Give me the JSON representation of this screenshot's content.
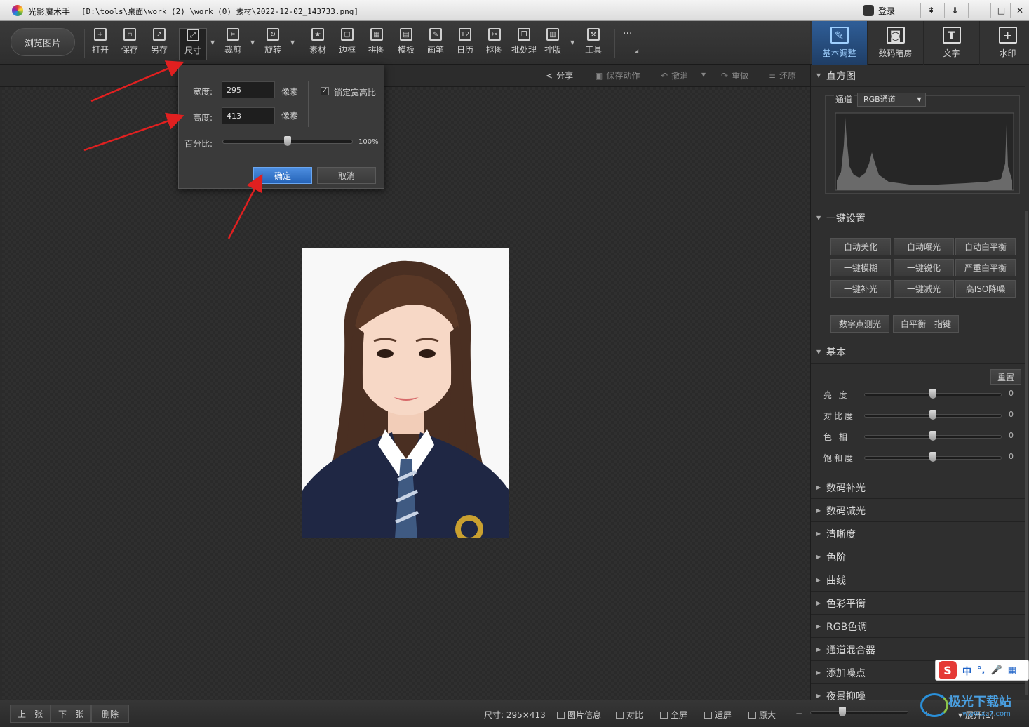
{
  "window": {
    "app_title": "光影魔术手",
    "file_path": "[D:\\tools\\桌面\\work (2) \\work (0) 素材\\2022-12-02_143733.png]",
    "login_label": "登录",
    "controls": [
      "⇞",
      "⇓",
      "—",
      "□",
      "✕"
    ]
  },
  "toolbar": {
    "browse_label": "浏览图片",
    "tools": [
      {
        "label": "打开",
        "icon": "open-icon",
        "glyph": "+"
      },
      {
        "label": "保存",
        "icon": "save-icon",
        "glyph": "▫"
      },
      {
        "label": "另存",
        "icon": "save-as-icon",
        "glyph": "↗"
      },
      {
        "label": "尺寸",
        "icon": "resize-icon",
        "glyph": "⤢"
      },
      {
        "label": "裁剪",
        "icon": "crop-icon",
        "glyph": "⌗"
      },
      {
        "label": "旋转",
        "icon": "rotate-icon",
        "glyph": "↻"
      },
      {
        "label": "素材",
        "icon": "material-icon",
        "glyph": "★"
      },
      {
        "label": "边框",
        "icon": "frame-icon",
        "glyph": "▢"
      },
      {
        "label": "拼图",
        "icon": "collage-icon",
        "glyph": "▦"
      },
      {
        "label": "模板",
        "icon": "template-icon",
        "glyph": "▤"
      },
      {
        "label": "画笔",
        "icon": "brush-icon",
        "glyph": "✎"
      },
      {
        "label": "日历",
        "icon": "calendar-icon",
        "glyph": "12"
      },
      {
        "label": "抠图",
        "icon": "cutout-icon",
        "glyph": "✂"
      },
      {
        "label": "批处理",
        "icon": "batch-icon",
        "glyph": "❐"
      },
      {
        "label": "排版",
        "icon": "layout-icon",
        "glyph": "▥"
      },
      {
        "label": "工具",
        "icon": "wrench-icon",
        "glyph": "⚒"
      }
    ],
    "more_label": "···"
  },
  "right_tabs": [
    {
      "label": "基本调整",
      "icon": "basic-adjust-icon",
      "glyph": "✎",
      "active": true
    },
    {
      "label": "数码暗房",
      "icon": "darkroom-icon",
      "glyph": "◙",
      "active": false
    },
    {
      "label": "文字",
      "icon": "text-icon",
      "glyph": "T",
      "active": false
    },
    {
      "label": "水印",
      "icon": "watermark-icon",
      "glyph": "+",
      "active": false
    }
  ],
  "subbar": {
    "share": "分享",
    "save_action": "保存动作",
    "undo": "撤消",
    "redo": "重做",
    "restore": "还原"
  },
  "size_dialog": {
    "width_label": "宽度:",
    "width_value": "295",
    "height_label": "高度:",
    "height_value": "413",
    "unit": "像素",
    "lock_ratio_label": "锁定宽高比",
    "lock_ratio_checked": true,
    "percent_label": "百分比:",
    "percent_value": "100%",
    "percent_slider_fraction": 0.5,
    "ok_label": "确定",
    "cancel_label": "取消"
  },
  "right_panel": {
    "histogram": {
      "title": "直方图",
      "channel_label": "通道",
      "channel_value": "RGB通道"
    },
    "one_click": {
      "title": "一键设置",
      "buttons": [
        "自动美化",
        "自动曝光",
        "自动白平衡",
        "一键模糊",
        "一键锐化",
        "严重白平衡",
        "一键补光",
        "一键减光",
        "高ISO降噪"
      ],
      "extra_buttons": [
        "数字点测光",
        "白平衡一指键"
      ]
    },
    "basic": {
      "title": "基本",
      "reset_label": "重置",
      "sliders": [
        {
          "label": "亮 度",
          "value": "0",
          "fraction": 0.5
        },
        {
          "label": "对比度",
          "value": "0",
          "fraction": 0.5
        },
        {
          "label": "色 相",
          "value": "0",
          "fraction": 0.5
        },
        {
          "label": "饱和度",
          "value": "0",
          "fraction": 0.5
        }
      ]
    },
    "collapsed_sections": [
      "数码补光",
      "数码减光",
      "清晰度",
      "色阶",
      "曲线",
      "色彩平衡",
      "RGB色调",
      "通道混合器",
      "添加噪点",
      "夜景抑噪"
    ]
  },
  "statusbar": {
    "prev": "上一张",
    "next": "下一张",
    "delete": "删除",
    "size_text": "尺寸: 295×413",
    "info": "图片信息",
    "compare": "对比",
    "fullscreen": "全屏",
    "fit": "适屏",
    "original": "原大",
    "minus": "−",
    "plus": "+",
    "expand": "展开(1)",
    "zoom_fraction": 0.33
  },
  "ime": {
    "logo": "S",
    "items": [
      "中",
      "°,",
      "🎤",
      "▦"
    ]
  },
  "watermark": {
    "text": "极光下载站",
    "url": "www.xz7.com"
  }
}
